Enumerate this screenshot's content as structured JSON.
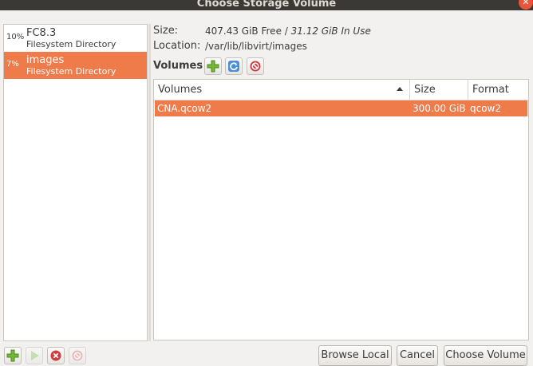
{
  "window": {
    "title": "Choose Storage Volume",
    "close_icon": "close-icon"
  },
  "pools": [
    {
      "usage": "10%",
      "name": "FC8.3",
      "type": "Filesystem Directory",
      "selected": false
    },
    {
      "usage": "7%",
      "name": "images",
      "type": "Filesystem Directory",
      "selected": true
    }
  ],
  "pool_info": {
    "size_label": "Size:",
    "free": "407.43 GiB Free",
    "separator": " / ",
    "in_use": "31.12 GiB In Use",
    "location_label": "Location:",
    "location": "/var/lib/libvirt/images"
  },
  "volumes_toolbar": {
    "label": "Volumes",
    "add_icon": "add-icon",
    "refresh_icon": "refresh-icon",
    "delete_icon": "delete-icon"
  },
  "volume_table": {
    "columns": [
      "Volumes",
      "Size",
      "Format"
    ],
    "sort_column": "Volumes",
    "sort_direction": "ascending",
    "rows": [
      {
        "name": "CNA.qcow2",
        "size": "300.00 GiB",
        "format": "qcow2",
        "selected": true
      }
    ]
  },
  "pool_toolbar": {
    "add_icon": "add-icon",
    "start_icon": "play-icon",
    "stop_icon": "stop-icon",
    "delete_icon": "delete-icon"
  },
  "buttons": {
    "browse_local": "Browse Local",
    "cancel": "Cancel",
    "choose_volume": "Choose Volume"
  },
  "colors": {
    "selection": "#ef7b4a",
    "titlebar": "#3a3935",
    "close_button": "#e9543a"
  }
}
